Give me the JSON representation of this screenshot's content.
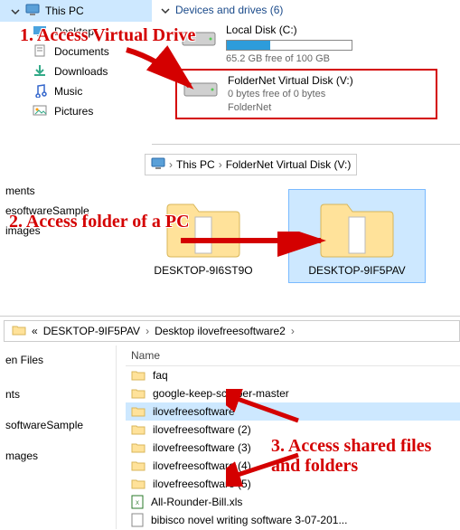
{
  "annotations": {
    "a1": "1. Access Virtual Drive",
    "a2": "2. Access folder of a PC",
    "a3": "3. Access shared files and folders"
  },
  "panel1": {
    "this_pc": "This PC",
    "nav": {
      "desktop": "Desktop",
      "documents": "Documents",
      "downloads": "Downloads",
      "music": "Music",
      "pictures": "Pictures"
    },
    "group_header": "Devices and drives (6)",
    "drive_c": {
      "title": "Local Disk (C:)",
      "sub": "65.2 GB free of 100 GB",
      "fill_pct": 35
    },
    "drive_v": {
      "title": "FolderNet Virtual Disk (V:)",
      "sub1": "0 bytes free of 0 bytes",
      "sub2": "FolderNet"
    }
  },
  "panel2": {
    "bc1": "This PC",
    "bc2": "FolderNet Virtual Disk (V:)",
    "side": {
      "ments": "ments",
      "sample": "esoftwareSample",
      "images": "images"
    },
    "folder1": "DESKTOP-9I6ST9O",
    "folder2": "DESKTOP-9IF5PAV"
  },
  "panel3": {
    "bc_prefix": "«",
    "bc1": "DESKTOP-9IF5PAV",
    "bc2": "Desktop ilovefreesoftware2",
    "header_name": "Name",
    "side": {
      "enfiles": "en Files",
      "nts": "nts",
      "sample": "softwareSample",
      "mages": "mages"
    },
    "rows": [
      "faq",
      "google-keep-scraper-master",
      "ilovefreesoftware",
      "ilovefreesoftware (2)",
      "ilovefreesoftware (3)",
      "ilovefreesoftware (4)",
      "ilovefreesoftware (5)",
      "All-Rounder-Bill.xls",
      "bibisco novel writing software 3-07-201..."
    ]
  }
}
